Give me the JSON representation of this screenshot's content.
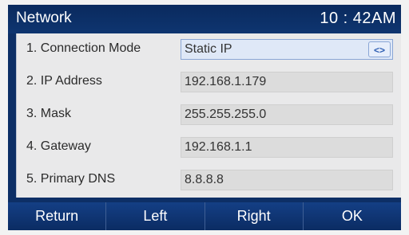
{
  "header": {
    "title": "Network",
    "time": "10 : 42AM"
  },
  "rows": [
    {
      "label": "1. Connection Mode",
      "value": "Static IP"
    },
    {
      "label": "2. IP Address",
      "value": "192.168.1.179"
    },
    {
      "label": "3. Mask",
      "value": "255.255.255.0"
    },
    {
      "label": "4. Gateway",
      "value": "192.168.1.1"
    },
    {
      "label": "5. Primary DNS",
      "value": "8.8.8.8"
    }
  ],
  "selector_glyph": "<>",
  "softkeys": [
    "Return",
    "Left",
    "Right",
    "OK"
  ]
}
